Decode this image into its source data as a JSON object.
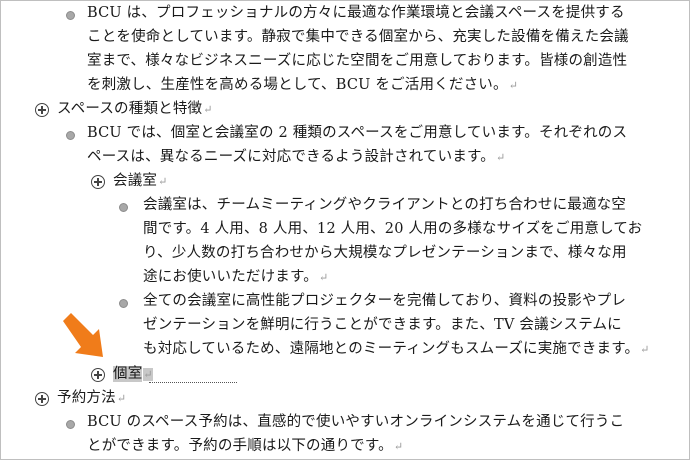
{
  "document": {
    "intro": {
      "line1": "BCU は、プロフェッショナルの方々に最適な作業環境と会議スペースを提供する",
      "line2": "ことを使命としています。静寂で集中できる個室から、充実した設備を備えた会議",
      "line3": "室まで、様々なビジネスニーズに応じた空間をご用意しております。皆様の創造性",
      "line4": "を刺激し、生産性を高める場として、BCU をご活用ください。"
    },
    "heading_spaces": "スペースの種類と特徴",
    "spaces_intro": {
      "line1": "BCU では、個室と会議室の 2 種類のスペースをご用意しています。それぞれのス",
      "line2": "ペースは、異なるニーズに対応できるよう設計されています。"
    },
    "heading_meeting_room": "会議室",
    "meeting_1": {
      "line1": "会議室は、チームミーティングやクライアントとの打ち合わせに最適な空",
      "line2": "間です。4 人用、8 人用、12 人用、20 人用の多様なサイズをご用意してお",
      "line3": "り、少人数の打ち合わせから大規模なプレゼンテーションまで、様々な用",
      "line4": "途にお使いいただけます。"
    },
    "meeting_2": {
      "line1": "全ての会議室に高性能プロジェクターを完備しており、資料の投影やプレ",
      "line2": "ゼンテーションを鮮明に行うことができます。また、TV 会議システムに",
      "line3": "も対応しているため、遠隔地とのミーティングもスムーズに実施できます。"
    },
    "heading_private_room": "個室",
    "heading_reservation": "予約方法",
    "reservation_intro": {
      "line1": "BCU のスペース予約は、直感的で使いやすいオンラインシステムを通じて行うこ",
      "line2": "とができます。予約の手順は以下の通りです。"
    }
  },
  "marks": {
    "paragraph": "↵"
  },
  "colors": {
    "arrow": "#f07c1a",
    "selection": "#c8c8c8"
  }
}
